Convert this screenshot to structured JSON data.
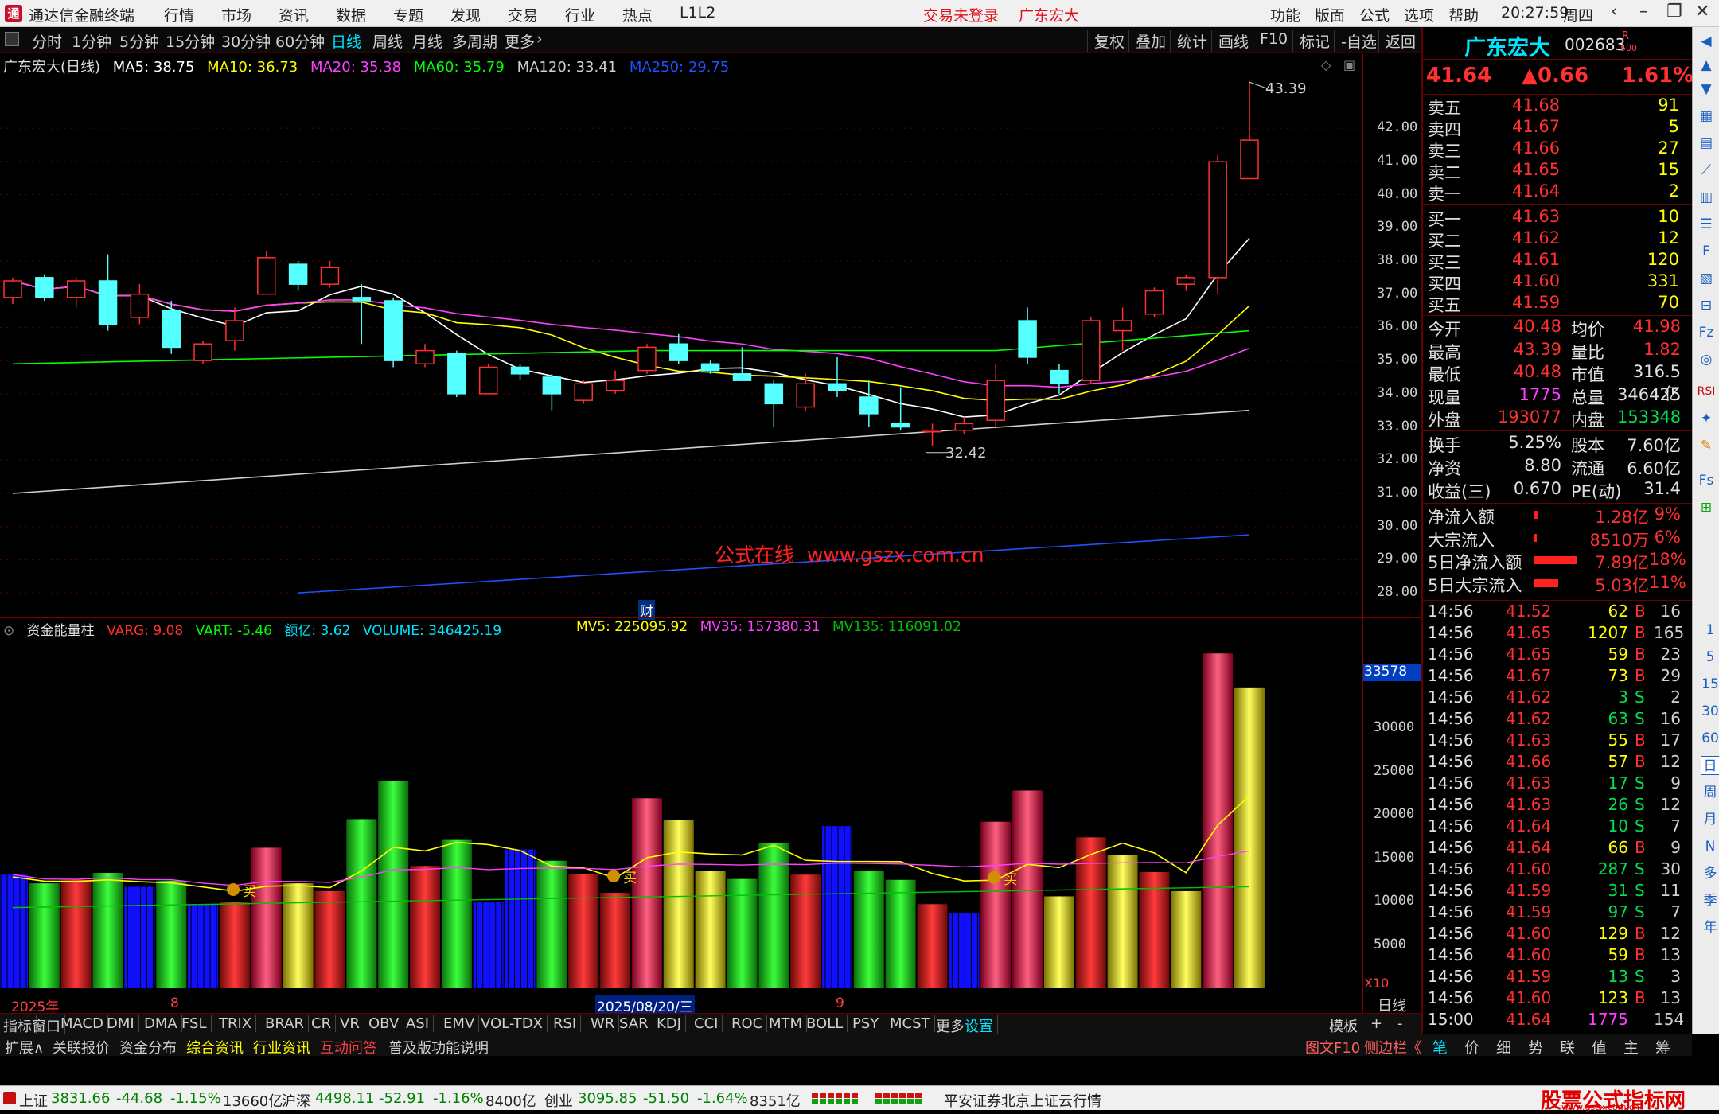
{
  "titlebar": {
    "app_title": "通达信金融终端",
    "menu": [
      "行情",
      "市场",
      "资讯",
      "数据",
      "专题",
      "发现",
      "交易",
      "行业",
      "热点",
      "L1L2"
    ],
    "trade_status": "交易未登录",
    "stock_name": "广东宏大",
    "right_menu": [
      "功能",
      "版面",
      "公式",
      "选项",
      "帮助"
    ],
    "time": "20:27:59",
    "weekday": "周四"
  },
  "period_bar": {
    "periods": [
      "分时",
      "1分钟",
      "5分钟",
      "15分钟",
      "30分钟",
      "60分钟",
      "日线",
      "周线",
      "月线",
      "多周期",
      "更多"
    ],
    "selected": "日线",
    "buttons": [
      "复权",
      "叠加",
      "统计",
      "画线",
      "F10",
      "标记",
      "-自选",
      "返回"
    ]
  },
  "main_chart": {
    "title": "广东宏大(日线)",
    "ma": [
      {
        "label": "MA5: 38.75",
        "color": "#ffffff"
      },
      {
        "label": "MA10: 36.73",
        "color": "#ffff00"
      },
      {
        "label": "MA20: 35.38",
        "color": "#ff40ff"
      },
      {
        "label": "MA60: 35.79",
        "color": "#00ff00"
      },
      {
        "label": "MA120: 33.41",
        "color": "#d0d0d0"
      },
      {
        "label": "MA250: 29.75",
        "color": "#2050ff"
      }
    ],
    "high_label": "43.39",
    "low_label": "32.42",
    "watermark": "公式在线  www.gszx.com.cn",
    "finance_marker": "财",
    "y_ticks": [
      "42.00",
      "41.00",
      "40.00",
      "39.00",
      "38.00",
      "37.00",
      "36.00",
      "35.00",
      "34.00",
      "33.00",
      "32.00",
      "31.00",
      "30.00",
      "29.00",
      "28.00"
    ]
  },
  "vol_chart": {
    "title": "资金能量柱",
    "legend": [
      {
        "label": "VARG: 9.08",
        "color": "#ff3030"
      },
      {
        "label": "VART: -5.46",
        "color": "#00ff00"
      },
      {
        "label": "额亿: 3.62",
        "color": "#00e5ff"
      },
      {
        "label": "VOLUME: 346425.19",
        "color": "#00e5ff"
      }
    ],
    "legend2": [
      {
        "label": "MV5: 225095.92",
        "color": "#ffff00"
      },
      {
        "label": "MV35: 157380.31",
        "color": "#ff40ff"
      },
      {
        "label": "MV135: 116091.02",
        "color": "#00c000"
      }
    ],
    "cursor_value": "33578",
    "y_ticks": [
      "30000",
      "25000",
      "20000",
      "15000",
      "10000",
      "5000"
    ],
    "unit": "X10",
    "buy_label": "买"
  },
  "chart_data": {
    "type": "candlestick",
    "title": "广东宏大(日线)",
    "ylim": [
      27.5,
      43.8
    ],
    "candles": [
      {
        "o": 36.9,
        "c": 37.4,
        "h": 37.5,
        "l": 36.7
      },
      {
        "o": 37.5,
        "c": 36.9,
        "h": 37.6,
        "l": 36.8
      },
      {
        "o": 36.9,
        "c": 37.4,
        "h": 37.5,
        "l": 36.6
      },
      {
        "o": 37.4,
        "c": 36.1,
        "h": 38.2,
        "l": 35.9
      },
      {
        "o": 36.3,
        "c": 37.0,
        "h": 37.3,
        "l": 36.1
      },
      {
        "o": 36.5,
        "c": 35.4,
        "h": 36.8,
        "l": 35.2
      },
      {
        "o": 35.0,
        "c": 35.5,
        "h": 35.6,
        "l": 34.9
      },
      {
        "o": 35.6,
        "c": 36.2,
        "h": 36.6,
        "l": 35.3
      },
      {
        "o": 37.0,
        "c": 38.1,
        "h": 38.3,
        "l": 37.0
      },
      {
        "o": 37.9,
        "c": 37.3,
        "h": 38.0,
        "l": 37.1
      },
      {
        "o": 37.3,
        "c": 37.8,
        "h": 38.0,
        "l": 37.2
      },
      {
        "o": 36.9,
        "c": 36.8,
        "h": 37.3,
        "l": 35.5
      },
      {
        "o": 36.8,
        "c": 35.0,
        "h": 36.9,
        "l": 34.8
      },
      {
        "o": 34.9,
        "c": 35.3,
        "h": 35.5,
        "l": 34.8
      },
      {
        "o": 35.2,
        "c": 34.0,
        "h": 35.3,
        "l": 33.9
      },
      {
        "o": 34.0,
        "c": 34.8,
        "h": 34.9,
        "l": 34.0
      },
      {
        "o": 34.8,
        "c": 34.6,
        "h": 34.9,
        "l": 34.4
      },
      {
        "o": 34.5,
        "c": 34.0,
        "h": 34.6,
        "l": 33.5
      },
      {
        "o": 33.8,
        "c": 34.3,
        "h": 34.4,
        "l": 33.7
      },
      {
        "o": 34.1,
        "c": 34.4,
        "h": 34.7,
        "l": 34.0
      },
      {
        "o": 34.7,
        "c": 35.4,
        "h": 35.5,
        "l": 34.6
      },
      {
        "o": 35.5,
        "c": 35.0,
        "h": 35.8,
        "l": 34.9
      },
      {
        "o": 34.9,
        "c": 34.7,
        "h": 35.0,
        "l": 34.6
      },
      {
        "o": 34.6,
        "c": 34.4,
        "h": 35.4,
        "l": 34.4
      },
      {
        "o": 34.3,
        "c": 33.7,
        "h": 34.4,
        "l": 33.0
      },
      {
        "o": 33.6,
        "c": 34.3,
        "h": 34.6,
        "l": 33.5
      },
      {
        "o": 34.3,
        "c": 34.1,
        "h": 35.1,
        "l": 33.9
      },
      {
        "o": 33.9,
        "c": 33.4,
        "h": 34.4,
        "l": 33.0
      },
      {
        "o": 33.1,
        "c": 33.0,
        "h": 34.2,
        "l": 32.9
      },
      {
        "o": 32.9,
        "c": 32.9,
        "h": 33.1,
        "l": 32.42
      },
      {
        "o": 32.9,
        "c": 33.1,
        "h": 33.3,
        "l": 32.8
      },
      {
        "o": 33.2,
        "c": 34.4,
        "h": 34.9,
        "l": 33.0
      },
      {
        "o": 36.2,
        "c": 35.1,
        "h": 36.6,
        "l": 34.9
      },
      {
        "o": 34.7,
        "c": 34.3,
        "h": 34.9,
        "l": 34.0
      },
      {
        "o": 34.4,
        "c": 36.2,
        "h": 36.3,
        "l": 34.3
      },
      {
        "o": 35.9,
        "c": 36.2,
        "h": 36.6,
        "l": 35.3
      },
      {
        "o": 36.4,
        "c": 37.1,
        "h": 37.2,
        "l": 36.3
      },
      {
        "o": 37.3,
        "c": 37.5,
        "h": 37.6,
        "l": 37.1
      },
      {
        "o": 37.5,
        "c": 40.99,
        "h": 41.2,
        "l": 37.0
      },
      {
        "o": 40.48,
        "c": 41.64,
        "h": 43.39,
        "l": 40.48
      }
    ],
    "volume": [
      {
        "v": 13100,
        "t": "B"
      },
      {
        "v": 12100,
        "t": "G"
      },
      {
        "v": 12500,
        "t": "R"
      },
      {
        "v": 13300,
        "t": "G"
      },
      {
        "v": 11700,
        "t": "B"
      },
      {
        "v": 12400,
        "t": "G"
      },
      {
        "v": 9700,
        "t": "B"
      },
      {
        "v": 10000,
        "t": "R"
      },
      {
        "v": 16200,
        "t": "P"
      },
      {
        "v": 12100,
        "t": "Y"
      },
      {
        "v": 11200,
        "t": "R"
      },
      {
        "v": 19500,
        "t": "G"
      },
      {
        "v": 23900,
        "t": "G"
      },
      {
        "v": 14100,
        "t": "R"
      },
      {
        "v": 17100,
        "t": "G"
      },
      {
        "v": 9900,
        "t": "B"
      },
      {
        "v": 16000,
        "t": "B"
      },
      {
        "v": 14700,
        "t": "G"
      },
      {
        "v": 13200,
        "t": "R"
      },
      {
        "v": 11000,
        "t": "R"
      },
      {
        "v": 21900,
        "t": "P"
      },
      {
        "v": 19400,
        "t": "Y"
      },
      {
        "v": 13500,
        "t": "Y"
      },
      {
        "v": 12600,
        "t": "G"
      },
      {
        "v": 16700,
        "t": "G"
      },
      {
        "v": 13100,
        "t": "R"
      },
      {
        "v": 18700,
        "t": "B"
      },
      {
        "v": 13500,
        "t": "G"
      },
      {
        "v": 12500,
        "t": "G"
      },
      {
        "v": 9700,
        "t": "R"
      },
      {
        "v": 8700,
        "t": "B"
      },
      {
        "v": 19200,
        "t": "P"
      },
      {
        "v": 22800,
        "t": "P"
      },
      {
        "v": 10600,
        "t": "Y"
      },
      {
        "v": 17400,
        "t": "R"
      },
      {
        "v": 15400,
        "t": "Y"
      },
      {
        "v": 13400,
        "t": "R"
      },
      {
        "v": 11200,
        "t": "Y"
      },
      {
        "v": 38600,
        "t": "P"
      },
      {
        "v": 34600,
        "t": "Y"
      }
    ],
    "vol_ylim": [
      0,
      40000
    ],
    "x_labels": [
      "2025年",
      "8",
      "2025/08/20/三",
      "9"
    ]
  },
  "quote": {
    "name": "广东宏大",
    "code": "002683",
    "badge": "R",
    "badge2": "500",
    "price": "41.64",
    "change": "▲0.66",
    "pct": "1.61%",
    "asks": [
      {
        "label": "卖五",
        "price": "41.68",
        "vol": "91"
      },
      {
        "label": "卖四",
        "price": "41.67",
        "vol": "5"
      },
      {
        "label": "卖三",
        "price": "41.66",
        "vol": "27"
      },
      {
        "label": "卖二",
        "price": "41.65",
        "vol": "15"
      },
      {
        "label": "卖一",
        "price": "41.64",
        "vol": "2"
      }
    ],
    "bids": [
      {
        "label": "买一",
        "price": "41.63",
        "vol": "10"
      },
      {
        "label": "买二",
        "price": "41.62",
        "vol": "12"
      },
      {
        "label": "买三",
        "price": "41.61",
        "vol": "120"
      },
      {
        "label": "买四",
        "price": "41.60",
        "vol": "331"
      },
      {
        "label": "买五",
        "price": "41.59",
        "vol": "70"
      }
    ],
    "stats": [
      {
        "l1": "今开",
        "v1": "40.48",
        "c1": "rt",
        "l2": "均价",
        "v2": "41.98",
        "c2": "rt"
      },
      {
        "l1": "最高",
        "v1": "43.39",
        "c1": "rt",
        "l2": "量比",
        "v2": "1.82",
        "c2": "rt"
      },
      {
        "l1": "最低",
        "v1": "40.48",
        "c1": "rt",
        "l2": "市值",
        "v2": "316.5亿",
        "c2": "wt"
      },
      {
        "l1": "现量",
        "v1": "1775",
        "c1": "mt",
        "l2": "总量",
        "v2": "346425",
        "c2": "wt"
      },
      {
        "l1": "外盘",
        "v1": "193077",
        "c1": "rt",
        "l2": "内盘",
        "v2": "153348",
        "c2": "gt"
      }
    ],
    "stats2": [
      {
        "l1": "换手",
        "v1": "5.25%",
        "l2": "股本",
        "v2": "7.60亿"
      },
      {
        "l1": "净资",
        "v1": "8.80",
        "l2": "流通",
        "v2": "6.60亿"
      },
      {
        "l1": "收益(三)",
        "v1": "0.670",
        "l2": "PE(动)",
        "v2": "31.4"
      }
    ],
    "flows": [
      {
        "label": "净流入额",
        "value": "1.28亿",
        "pct": "9%",
        "bar": 0.06
      },
      {
        "label": "大宗流入",
        "value": "8510万",
        "pct": "6%",
        "bar": 0.04
      },
      {
        "label": "5日净流入额",
        "value": "7.89亿",
        "pct": "18%",
        "bar": 0.9
      },
      {
        "label": "5日大宗流入",
        "value": "5.03亿",
        "pct": "11%",
        "bar": 0.5
      }
    ],
    "ticks": [
      {
        "t": "14:56",
        "p": "41.52",
        "v": "62",
        "s": "B",
        "n": "16"
      },
      {
        "t": "14:56",
        "p": "41.65",
        "v": "1207",
        "s": "B",
        "n": "165"
      },
      {
        "t": "14:56",
        "p": "41.65",
        "v": "59",
        "s": "B",
        "n": "23"
      },
      {
        "t": "14:56",
        "p": "41.67",
        "v": "73",
        "s": "B",
        "n": "29"
      },
      {
        "t": "14:56",
        "p": "41.62",
        "v": "3",
        "s": "S",
        "n": "2"
      },
      {
        "t": "14:56",
        "p": "41.62",
        "v": "63",
        "s": "S",
        "n": "16"
      },
      {
        "t": "14:56",
        "p": "41.63",
        "v": "55",
        "s": "B",
        "n": "17"
      },
      {
        "t": "14:56",
        "p": "41.66",
        "v": "57",
        "s": "B",
        "n": "12"
      },
      {
        "t": "14:56",
        "p": "41.63",
        "v": "17",
        "s": "S",
        "n": "9"
      },
      {
        "t": "14:56",
        "p": "41.63",
        "v": "26",
        "s": "S",
        "n": "12"
      },
      {
        "t": "14:56",
        "p": "41.64",
        "v": "10",
        "s": "S",
        "n": "7"
      },
      {
        "t": "14:56",
        "p": "41.64",
        "v": "66",
        "s": "B",
        "n": "9"
      },
      {
        "t": "14:56",
        "p": "41.60",
        "v": "287",
        "s": "S",
        "n": "30"
      },
      {
        "t": "14:56",
        "p": "41.59",
        "v": "31",
        "s": "S",
        "n": "11"
      },
      {
        "t": "14:56",
        "p": "41.59",
        "v": "97",
        "s": "S",
        "n": "7"
      },
      {
        "t": "14:56",
        "p": "41.60",
        "v": "129",
        "s": "B",
        "n": "12"
      },
      {
        "t": "14:56",
        "p": "41.60",
        "v": "59",
        "s": "B",
        "n": "13"
      },
      {
        "t": "14:56",
        "p": "41.59",
        "v": "13",
        "s": "S",
        "n": "3"
      },
      {
        "t": "14:56",
        "p": "41.60",
        "v": "123",
        "s": "B",
        "n": "13"
      },
      {
        "t": "15:00",
        "p": "41.64",
        "v": "1775",
        "s": "",
        "n": "154"
      }
    ],
    "bottom_tabs": [
      "笔",
      "价",
      "细",
      "势",
      "联",
      "值",
      "主",
      "筹"
    ]
  },
  "icon_strip": {
    "labels": [
      "1",
      "5",
      "15",
      "30",
      "60",
      "日",
      "周",
      "月",
      "N",
      "多",
      "季",
      "年"
    ]
  },
  "indicator_bar": {
    "items": [
      "指标",
      "窗口",
      "MACD",
      "DMI",
      "DMA",
      "FSL",
      "TRIX",
      "BRAR",
      "CR",
      "VR",
      "OBV",
      "ASI",
      "EMV",
      "VOL-TDX",
      "RSI",
      "WR",
      "SAR",
      "KDJ",
      "CCI",
      "ROC",
      "MTM",
      "BOLL",
      "PSY",
      "MCST",
      "更多",
      "设置"
    ],
    "right": [
      "模板",
      "+",
      "-"
    ],
    "period_label": "日线"
  },
  "ext_bar": {
    "items": [
      "扩展∧",
      "关联报价",
      "资金分布",
      "综合资讯",
      "行业资讯",
      "互动问答",
      "普及版功能说明"
    ],
    "right": [
      "图文F10",
      "侧边栏《"
    ]
  },
  "status_bar": {
    "indices": [
      {
        "name": "上证",
        "value": "3831.66",
        "chg": "-44.68",
        "pct": "-1.15%",
        "amt": "13660亿"
      },
      {
        "name": "沪深",
        "value": "4498.11",
        "chg": "-52.91",
        "pct": "-1.16%",
        "amt": "8400亿"
      },
      {
        "name": "创业",
        "value": "3095.85",
        "chg": "-51.50",
        "pct": "-1.64%",
        "amt": "8351亿"
      }
    ],
    "broker": "平安证券北京上证云行情",
    "brand": "股票公式指标网",
    "brand_url": "www.gszx.com.cn"
  }
}
